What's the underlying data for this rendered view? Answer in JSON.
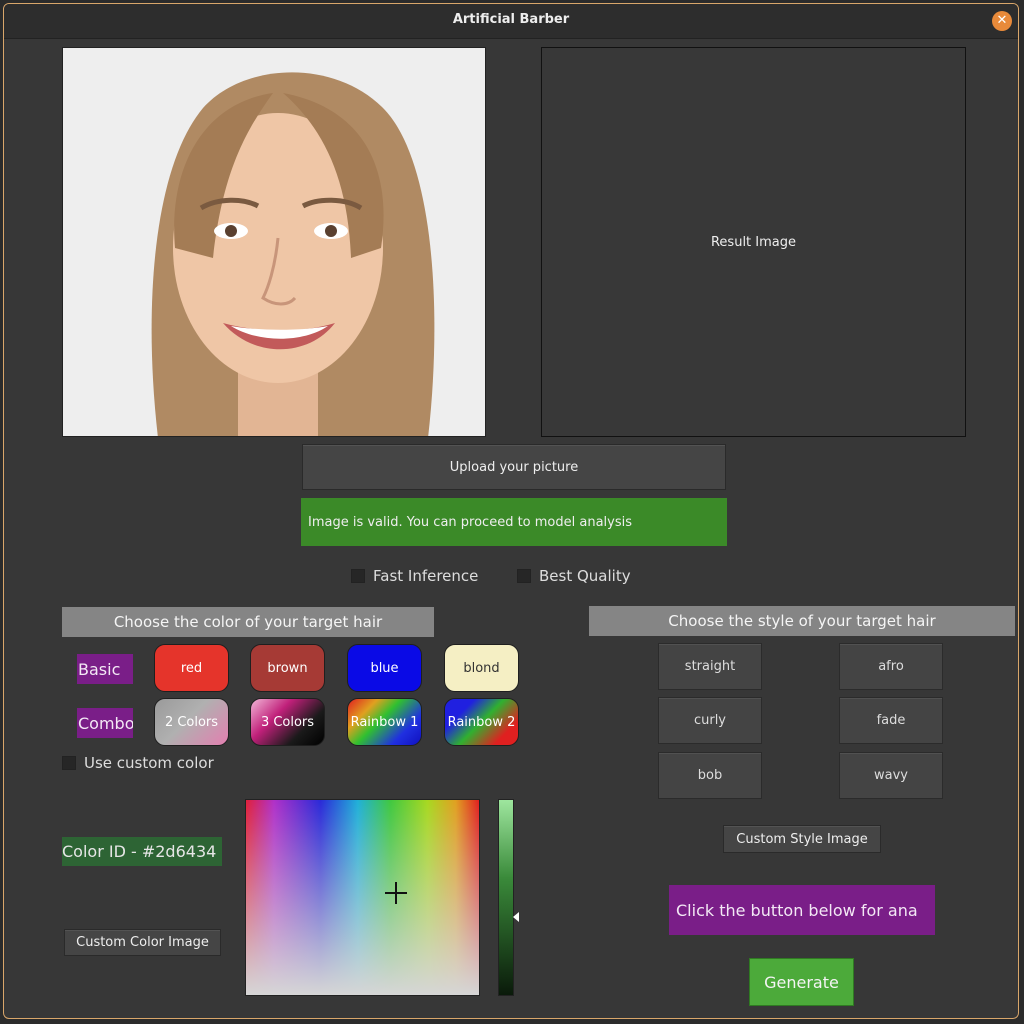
{
  "window": {
    "title": "Artificial Barber",
    "close_icon": "close-icon"
  },
  "images": {
    "result_label": "Result Image"
  },
  "upload": {
    "button_label": "Upload your picture"
  },
  "status": {
    "text": "Image is valid. You can proceed to model analysis",
    "color": "#3b8a28"
  },
  "options": {
    "fast_inference": "Fast Inference",
    "best_quality": "Best Quality"
  },
  "color_section": {
    "header": "Choose the color of your target hair",
    "basic_label": "Basic",
    "combo_label": "Combo",
    "basic_colors": [
      {
        "label": "red",
        "color": "#e5342b"
      },
      {
        "label": "brown",
        "color": "#a63a35"
      },
      {
        "label": "blue",
        "color": "#0a0ae6"
      },
      {
        "label": "blond",
        "color": "#f5efc4"
      }
    ],
    "combo_colors": [
      {
        "label": "2 Colors"
      },
      {
        "label": "3 Colors"
      },
      {
        "label": "Rainbow 1"
      },
      {
        "label": "Rainbow 2"
      }
    ],
    "custom_color_label": "Use custom color",
    "color_id": "Color ID - #2d6434",
    "custom_color_image_button": "Custom Color Image"
  },
  "style_section": {
    "header": "Choose the style of your target hair",
    "styles": [
      "straight",
      "afro",
      "curly",
      "fade",
      "bob",
      "wavy"
    ],
    "custom_style_button": "Custom Style Image",
    "hint": "Click the button below for ana",
    "generate_button": "Generate"
  }
}
